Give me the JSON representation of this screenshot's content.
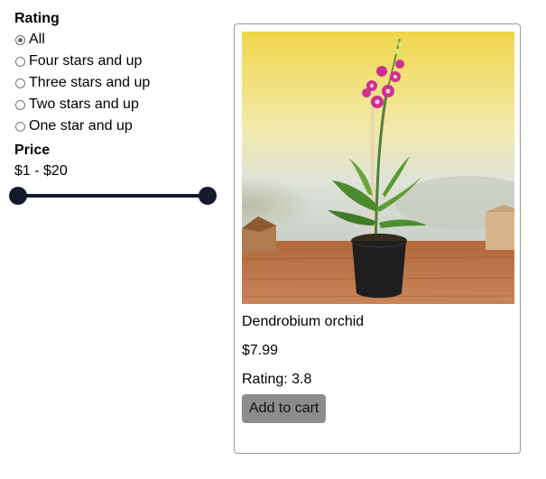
{
  "filters": {
    "rating_title": "Rating",
    "rating_options": [
      {
        "label": "All",
        "selected": true
      },
      {
        "label": "Four stars and up",
        "selected": false
      },
      {
        "label": "Three stars and up",
        "selected": false
      },
      {
        "label": "Two stars and up",
        "selected": false
      },
      {
        "label": "One star and up",
        "selected": false
      }
    ],
    "price_title": "Price",
    "price_range": "$1 - $20",
    "slider_color": "#131a2a"
  },
  "product": {
    "name": "Dendrobium orchid",
    "price": "$7.99",
    "rating": "Rating: 3.8",
    "add_label": "Add to cart"
  },
  "colors": {
    "button_bg": "#8c8c8c",
    "card_border": "#999999"
  }
}
